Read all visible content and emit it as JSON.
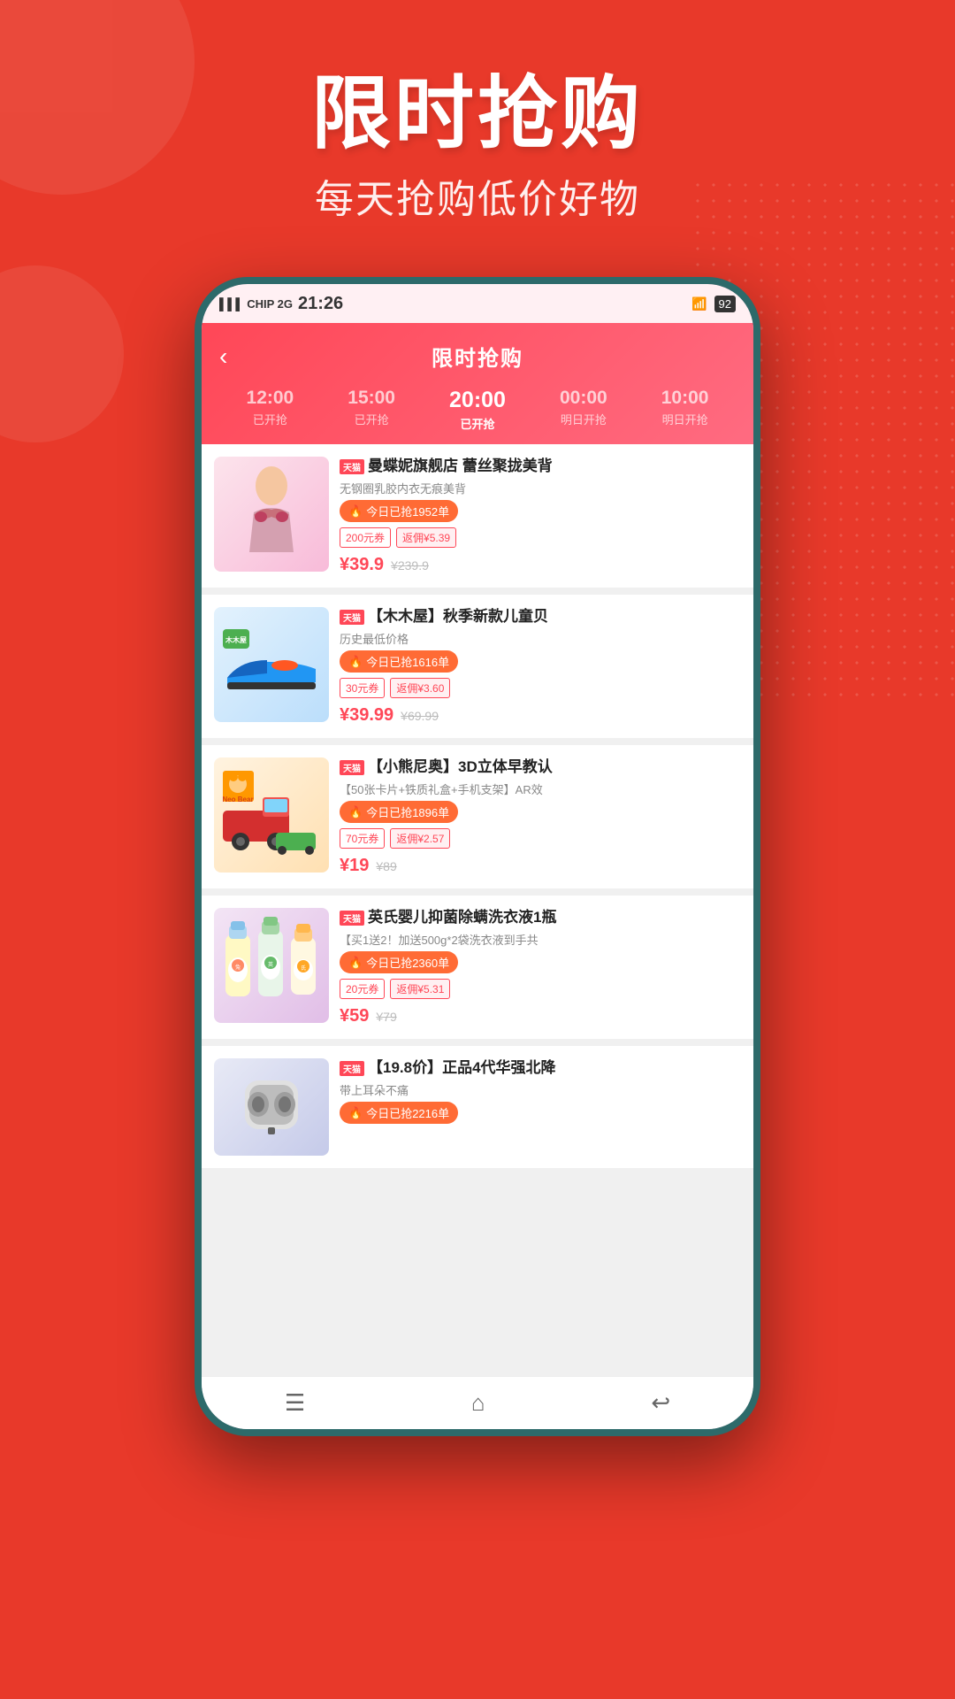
{
  "background": {
    "color": "#e8392a"
  },
  "header": {
    "title": "限时抢购",
    "subtitle": "每天抢购低价好物"
  },
  "phone": {
    "status_bar": {
      "carrier": "CHIP 2G",
      "time": "21:26",
      "wifi": "WiFi",
      "battery": "92"
    },
    "app": {
      "nav_title": "限时抢购",
      "back_label": "‹",
      "time_slots": [
        {
          "time": "12:00",
          "status": "已开抢",
          "active": false
        },
        {
          "time": "15:00",
          "status": "已开抢",
          "active": false
        },
        {
          "time": "20:00",
          "status": "已开抢",
          "active": true
        },
        {
          "time": "00:00",
          "status": "明日开抢",
          "active": false
        },
        {
          "time": "10:00",
          "status": "明日开抢",
          "active": false
        }
      ],
      "products": [
        {
          "shop_badge": "天猫",
          "name": "曼蝶妮旗舰店  蕾丝聚拢美背",
          "desc": "无钢圈乳胶内衣无痕美背",
          "flash_text": "今日已抢1952单",
          "coupon": "200元券",
          "cashback": "返佣¥5.39",
          "price_current": "¥39.9",
          "price_original": "¥239.9",
          "img_type": "bra",
          "img_emoji": "👙"
        },
        {
          "shop_badge": "天猫",
          "name": "【木木屋】秋季新款儿童贝",
          "desc": "历史最低价格",
          "flash_text": "今日已抢1616单",
          "coupon": "30元券",
          "cashback": "返佣¥3.60",
          "price_current": "¥39.99",
          "price_original": "¥69.99",
          "img_type": "shoes",
          "img_emoji": "👟"
        },
        {
          "shop_badge": "天猫",
          "name": "【小熊尼奥】3D立体早教认",
          "desc": "【50张卡片+铁质礼盒+手机支架】AR效",
          "flash_text": "今日已抢1896单",
          "coupon": "70元券",
          "cashback": "返佣¥2.57",
          "price_current": "¥19",
          "price_original": "¥89",
          "img_type": "toy",
          "img_emoji": "🚗"
        },
        {
          "shop_badge": "天猫",
          "name": "英氏婴儿抑菌除螨洗衣液1瓶",
          "desc": "【买1送2！加送500g*2袋洗衣液到手共",
          "flash_text": "今日已抢2360单",
          "coupon": "20元券",
          "cashback": "返佣¥5.31",
          "price_current": "¥59",
          "price_original": "¥79",
          "img_type": "liquid",
          "img_emoji": "🧴"
        },
        {
          "shop_badge": "天猫",
          "name": "【19.8价】正品4代华强北降",
          "desc": "带上耳朵不痛",
          "flash_text": "今日已抢2216单",
          "coupon": "",
          "cashback": "",
          "price_current": "",
          "price_original": "",
          "img_type": "earphone",
          "img_emoji": "🎧"
        }
      ],
      "bottom_nav": {
        "menu_icon": "☰",
        "home_icon": "⌂",
        "back_icon": "↩"
      }
    }
  }
}
